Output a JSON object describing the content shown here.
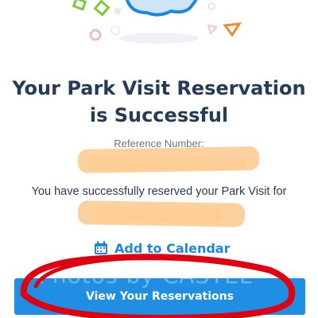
{
  "header": {
    "title": "Your Park Visit Reservation is Successful"
  },
  "reference": {
    "label": "Reference Number:",
    "value": "",
    "redacted": true
  },
  "message": {
    "text": "You have successfully reserved your Park Visit for",
    "date": "",
    "redacted": true
  },
  "actions": {
    "add_to_calendar": "Add to Calendar",
    "view_reservations": "View Your Reservations"
  },
  "watermark": "Photos by CASTEL",
  "colors": {
    "title": "#253b56",
    "link": "#1e86e0",
    "button": "#1f8ee3",
    "redaction": "#fbc98d",
    "annotation": "#e0000f"
  },
  "icons": [
    "calendar-icon",
    "cloud-illustration"
  ]
}
